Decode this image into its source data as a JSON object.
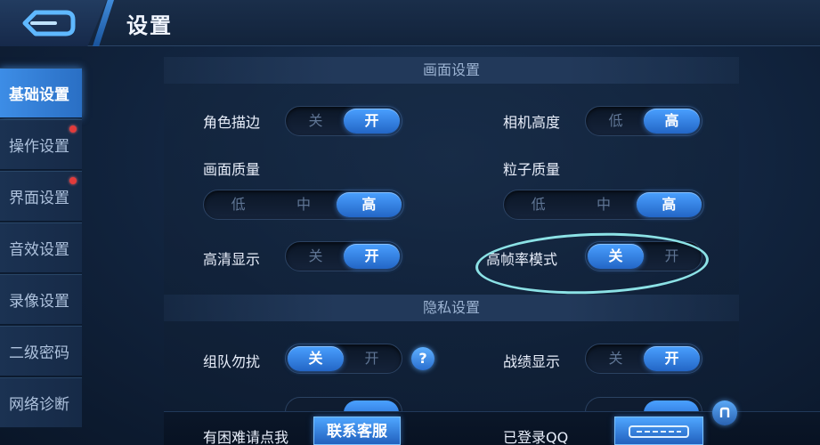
{
  "header": {
    "title": "设置"
  },
  "sidebar": {
    "items": [
      {
        "label": "基础设置",
        "active": true,
        "badge": false
      },
      {
        "label": "操作设置",
        "active": false,
        "badge": true
      },
      {
        "label": "界面设置",
        "active": false,
        "badge": true
      },
      {
        "label": "音效设置",
        "active": false,
        "badge": false
      },
      {
        "label": "录像设置",
        "active": false,
        "badge": false
      },
      {
        "label": "二级密码",
        "active": false,
        "badge": false
      },
      {
        "label": "网络诊断",
        "active": false,
        "badge": false
      }
    ]
  },
  "graphics": {
    "section_title": "画面设置",
    "outline": {
      "label": "角色描边",
      "options": [
        "关",
        "开"
      ],
      "selected": "开"
    },
    "camera_height": {
      "label": "相机高度",
      "options": [
        "低",
        "高"
      ],
      "selected": "高"
    },
    "quality": {
      "label": "画面质量",
      "options": [
        "低",
        "中",
        "高"
      ],
      "selected": "高"
    },
    "particle": {
      "label": "粒子质量",
      "options": [
        "低",
        "中",
        "高"
      ],
      "selected": "高"
    },
    "hd_display": {
      "label": "高清显示",
      "options": [
        "关",
        "开"
      ],
      "selected": "开"
    },
    "high_fps": {
      "label": "高帧率模式",
      "options": [
        "关",
        "开"
      ],
      "selected": "关"
    }
  },
  "privacy": {
    "section_title": "隐私设置",
    "team_dnd": {
      "label": "组队勿扰",
      "options": [
        "关",
        "开"
      ],
      "selected": "关",
      "help": "?"
    },
    "record_display": {
      "label": "战绩显示",
      "options": [
        "关",
        "开"
      ],
      "selected": "开"
    }
  },
  "footer": {
    "help_text": "有困难请点我",
    "contact_button": "联系客服",
    "login_status": "已登录QQ"
  },
  "colors": {
    "accent": "#3d8de6",
    "highlight": "#8ce2e6",
    "badge": "#e23b3b"
  }
}
